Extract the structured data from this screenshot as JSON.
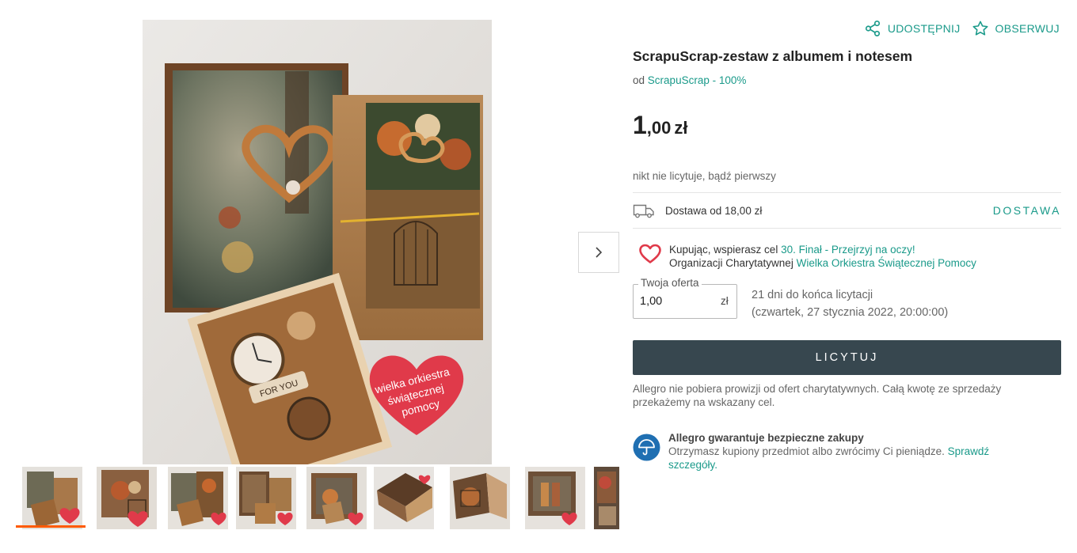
{
  "product": {
    "title": "ScrapuScrap-zestaw z albumem i notesem",
    "seller_prefix": "od",
    "seller_name": "ScrapuScrap - 100%",
    "price_int": "1",
    "price_dec": ",00",
    "price_currency": "zł",
    "bids_info": "nikt nie licytuje, bądź pierwszy"
  },
  "actions": {
    "share_label": "UDOSTĘPNIJ",
    "watch_label": "OBSERWUJ"
  },
  "delivery": {
    "text": "Dostawa od 18,00 zł",
    "link_label": "DOSTAWA"
  },
  "charity": {
    "line1_prefix": "Kupując, wspierasz cel",
    "campaign_link": "30. Finał - Przejrzyj na oczy!",
    "line2_prefix": "Organizacji Charytatywnej",
    "org_link": "Wielka Orkiestra Świątecznej Pomocy"
  },
  "offer": {
    "label": "Twoja oferta",
    "value": "1,00",
    "currency": "zł",
    "time_left": "21 dni do końca licytacji",
    "end_date": "(czwartek, 27 stycznia 2022, 20:00:00)"
  },
  "bid_button_label": "LICYTUJ",
  "note": "Allegro nie pobiera prowizji od ofert charytatywnych. Całą kwotę ze sprzedaży przekażemy na wskazany cel.",
  "guarantee": {
    "title": "Allegro gwarantuje bezpieczne zakupy",
    "body": "Otrzymasz kupiony przedmiot albo zwrócimy Ci pieniądze.",
    "link": "Sprawdź szczegóły."
  },
  "main_image": {
    "sticker_text": [
      "wielka orkiestra",
      "świątecznej",
      "pomocy"
    ],
    "tag_text": "FOR YOU"
  },
  "colors": {
    "accent": "#1a9a8a",
    "button": "#37474f",
    "active_thumb_bar": "#ff5a00",
    "heart": "#e03a4a",
    "shield": "#1f6fb2"
  }
}
